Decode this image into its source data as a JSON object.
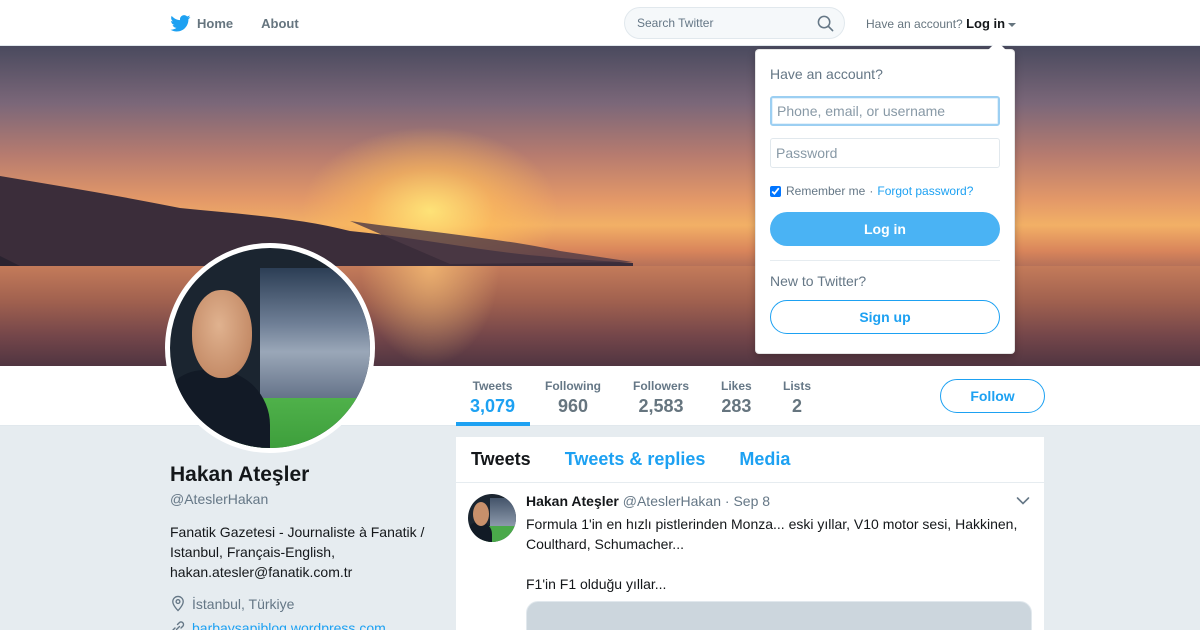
{
  "nav": {
    "home_label": "Home",
    "about_label": "About",
    "search_placeholder": "Search Twitter",
    "have_account_text": "Have an account?",
    "login_label": "Log in"
  },
  "profile": {
    "name": "Hakan Ateşler",
    "handle": "@AteslerHakan",
    "bio": "Fanatik Gazetesi - Journaliste à Fanatik / Istanbul, Français-English, hakan.atesler@fanatik.com.tr",
    "location": "İstanbul, Türkiye",
    "website": "barbaysapiblog.wordpress.com"
  },
  "stats": [
    {
      "label": "Tweets",
      "value": "3,079"
    },
    {
      "label": "Following",
      "value": "960"
    },
    {
      "label": "Followers",
      "value": "2,583"
    },
    {
      "label": "Likes",
      "value": "283"
    },
    {
      "label": "Lists",
      "value": "2"
    }
  ],
  "follow_label": "Follow",
  "timeline": {
    "tabs": [
      "Tweets",
      "Tweets & replies",
      "Media"
    ],
    "tweet": {
      "name": "Hakan Ateşler",
      "handle": "@AteslerHakan",
      "separator": "·",
      "date": "Sep 8",
      "text_line1": "Formula 1'in en hızlı pistlerinden Monza... eski yıllar, V10 motor sesi, Hakkinen, Coulthard, Schumacher...",
      "text_line2": "F1'in F1 olduğu yıllar..."
    }
  },
  "login_dropdown": {
    "title": "Have an account?",
    "username_placeholder": "Phone, email, or username",
    "password_placeholder": "Password",
    "remember_label": "Remember me",
    "separator": "·",
    "forgot_label": "Forgot password?",
    "login_button": "Log in",
    "new_text": "New to Twitter?",
    "signup_button": "Sign up",
    "remember_checked": true
  },
  "colors": {
    "accent": "#1da1f2",
    "login_button": "#4ab3f4",
    "background": "#e6ecf0"
  }
}
